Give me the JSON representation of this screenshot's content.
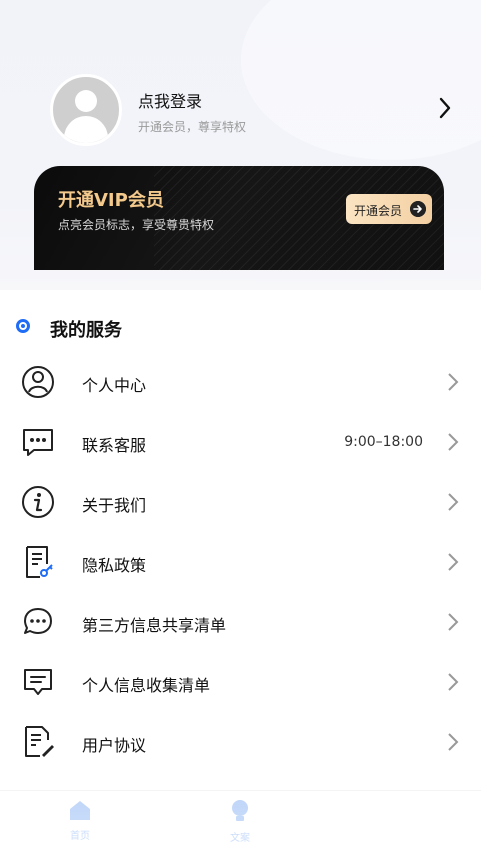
{
  "profile": {
    "login_text": "点我登录",
    "sub_text": "开通会员，尊享特权"
  },
  "vip": {
    "title": "开通VIP会员",
    "desc": "点亮会员标志，享受尊贵特权",
    "button": "开通会员"
  },
  "section": {
    "title": "我的服务"
  },
  "services": [
    {
      "label": "个人中心",
      "icon": "user-circle-icon",
      "extra": ""
    },
    {
      "label": "联系客服",
      "icon": "chat-bubble-icon",
      "extra": "9:00–18:00"
    },
    {
      "label": "关于我们",
      "icon": "info-icon",
      "extra": ""
    },
    {
      "label": "隐私政策",
      "icon": "document-key-icon",
      "extra": ""
    },
    {
      "label": "第三方信息共享清单",
      "icon": "chat-dots-icon",
      "extra": ""
    },
    {
      "label": "个人信息收集清单",
      "icon": "message-lines-icon",
      "extra": ""
    },
    {
      "label": "用户协议",
      "icon": "document-sign-icon",
      "extra": ""
    }
  ],
  "tabs": [
    {
      "label": "首页",
      "icon": "home-icon"
    },
    {
      "label": "文案",
      "icon": "lightbulb-icon"
    }
  ],
  "colors": {
    "accent": "#1f6df6",
    "vip_gold": "#f3c98c",
    "tab_inactive": "#9bbef5"
  }
}
